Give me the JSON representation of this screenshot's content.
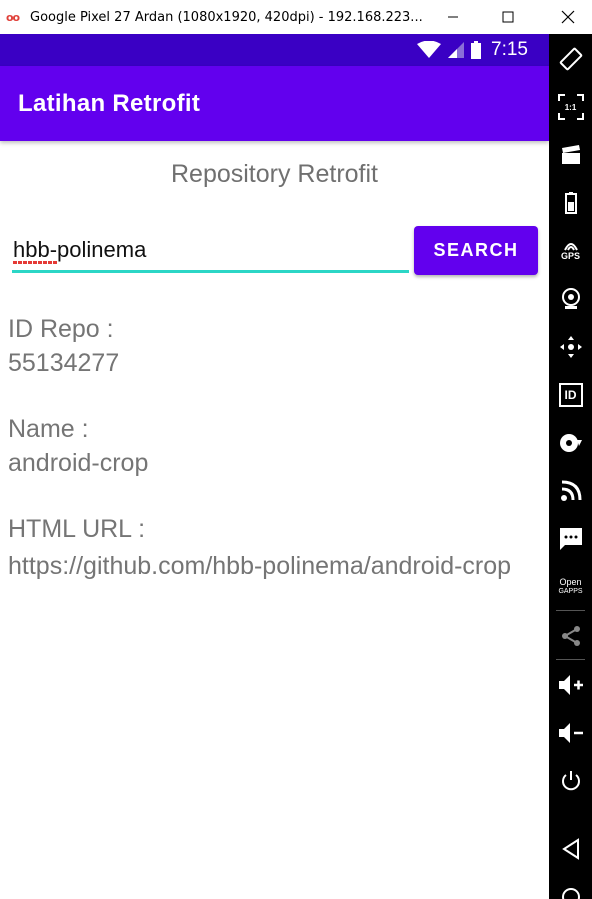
{
  "window": {
    "title": "Google Pixel 27 Ardan (1080x1920, 420dpi) - 192.168.223...",
    "logo_text": "oo"
  },
  "status_bar": {
    "time": "7:15"
  },
  "app_bar": {
    "title": "Latihan Retrofit"
  },
  "heading": "Repository Retrofit",
  "search": {
    "value": "hbb-polinema",
    "button_label": "SEARCH"
  },
  "fields": {
    "id_label": "ID Repo :",
    "id_value": "55134277",
    "name_label": "Name :",
    "name_value": "android-crop",
    "url_label": "HTML URL :",
    "url_value": "https://github.com/hbb-polinema/android-crop"
  },
  "toolbar": {
    "zoom_text": "1:1",
    "gps_text": "GPS",
    "id_text": "ID",
    "open_gapps_line1": "Open",
    "open_gapps_line2": "GAPPS"
  },
  "colors": {
    "status_bar": "#3a00c4",
    "app_bar": "#6200ee",
    "input_underline": "#2bd6c6",
    "toolbar_bg": "#000000"
  }
}
